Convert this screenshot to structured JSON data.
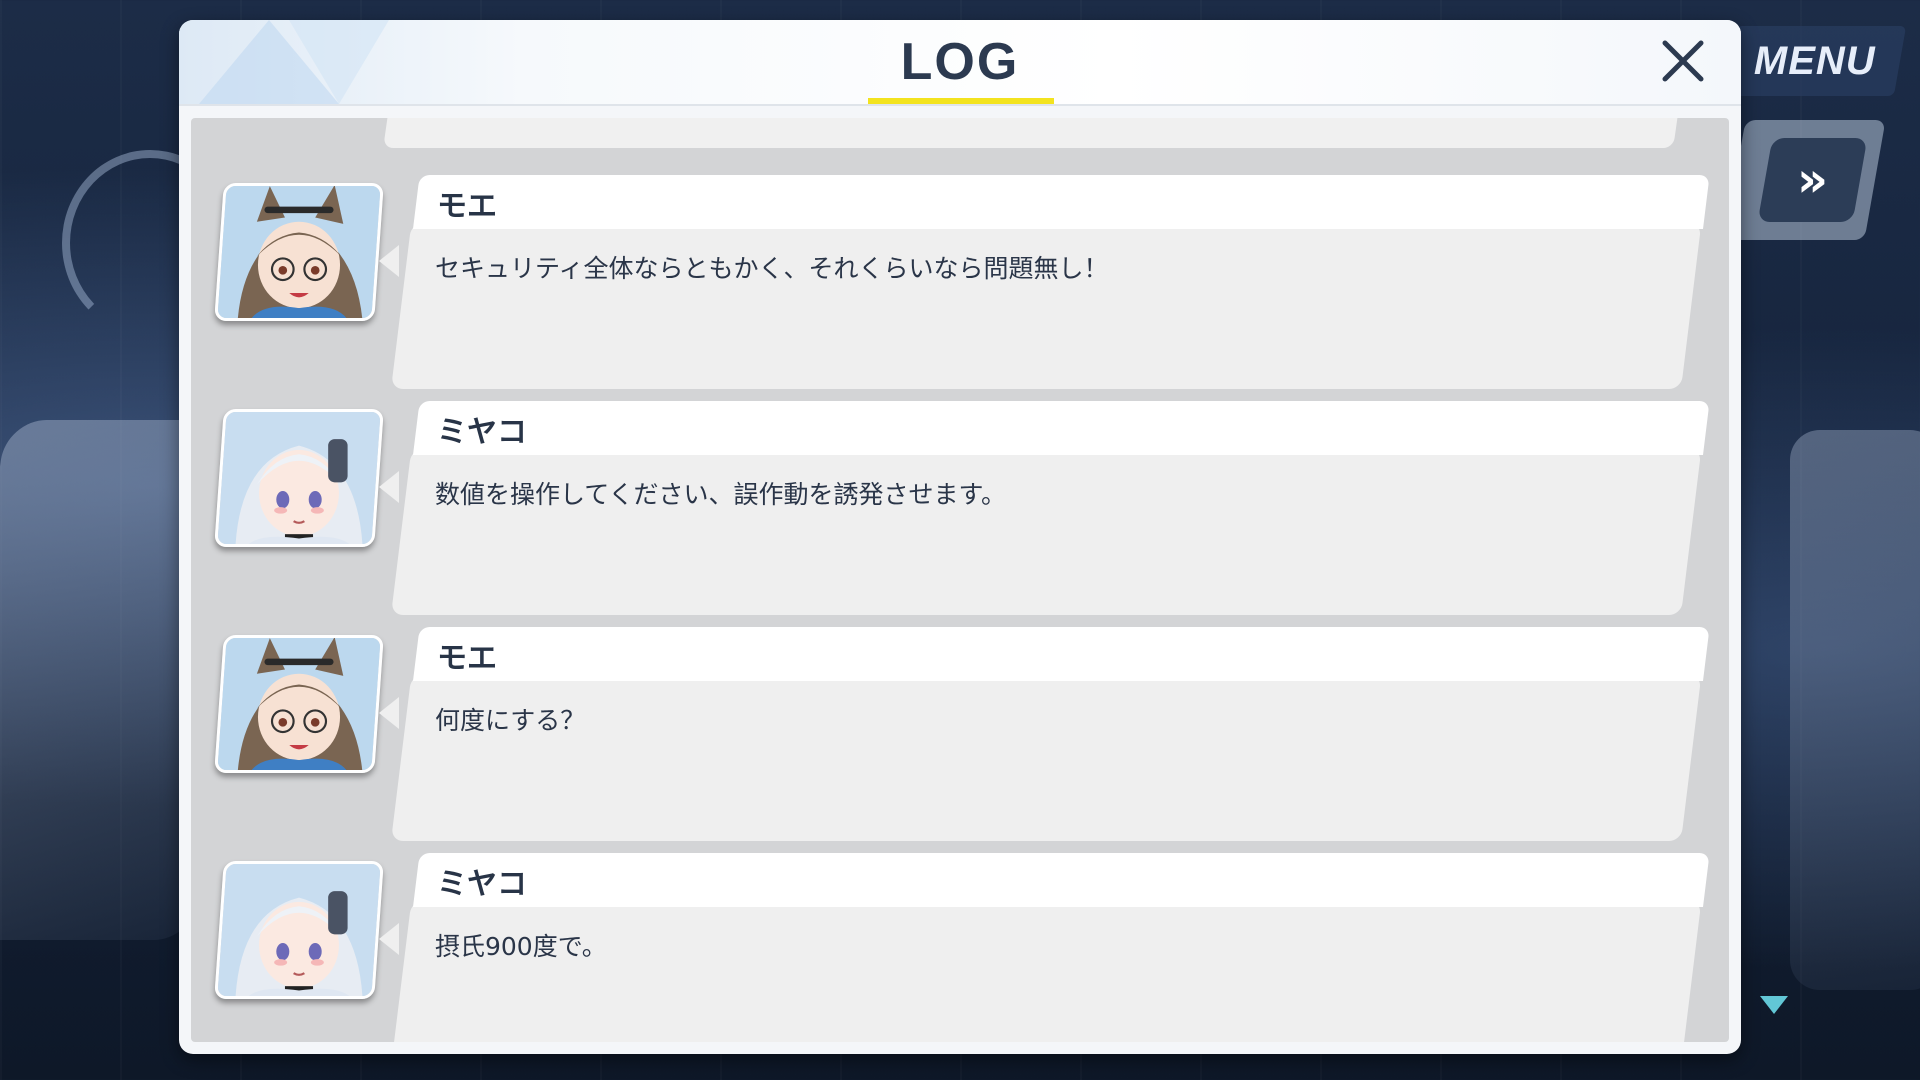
{
  "dialog": {
    "title": "LOG",
    "accent_color": "#f3e31f"
  },
  "hud": {
    "menu_label": "MENU",
    "fast_forward_icon": "double-chevron-right-icon"
  },
  "log_entries": [
    {
      "speaker": "モエ",
      "text": "セキュリティ全体ならともかく、それくらいなら問題無し！",
      "portrait": "moe"
    },
    {
      "speaker": "ミヤコ",
      "text": "数値を操作してください、誤作動を誘発させます。",
      "portrait": "miyako"
    },
    {
      "speaker": "モエ",
      "text": "何度にする？",
      "portrait": "moe"
    },
    {
      "speaker": "ミヤコ",
      "text": "摂氏900度で。",
      "portrait": "miyako"
    }
  ]
}
